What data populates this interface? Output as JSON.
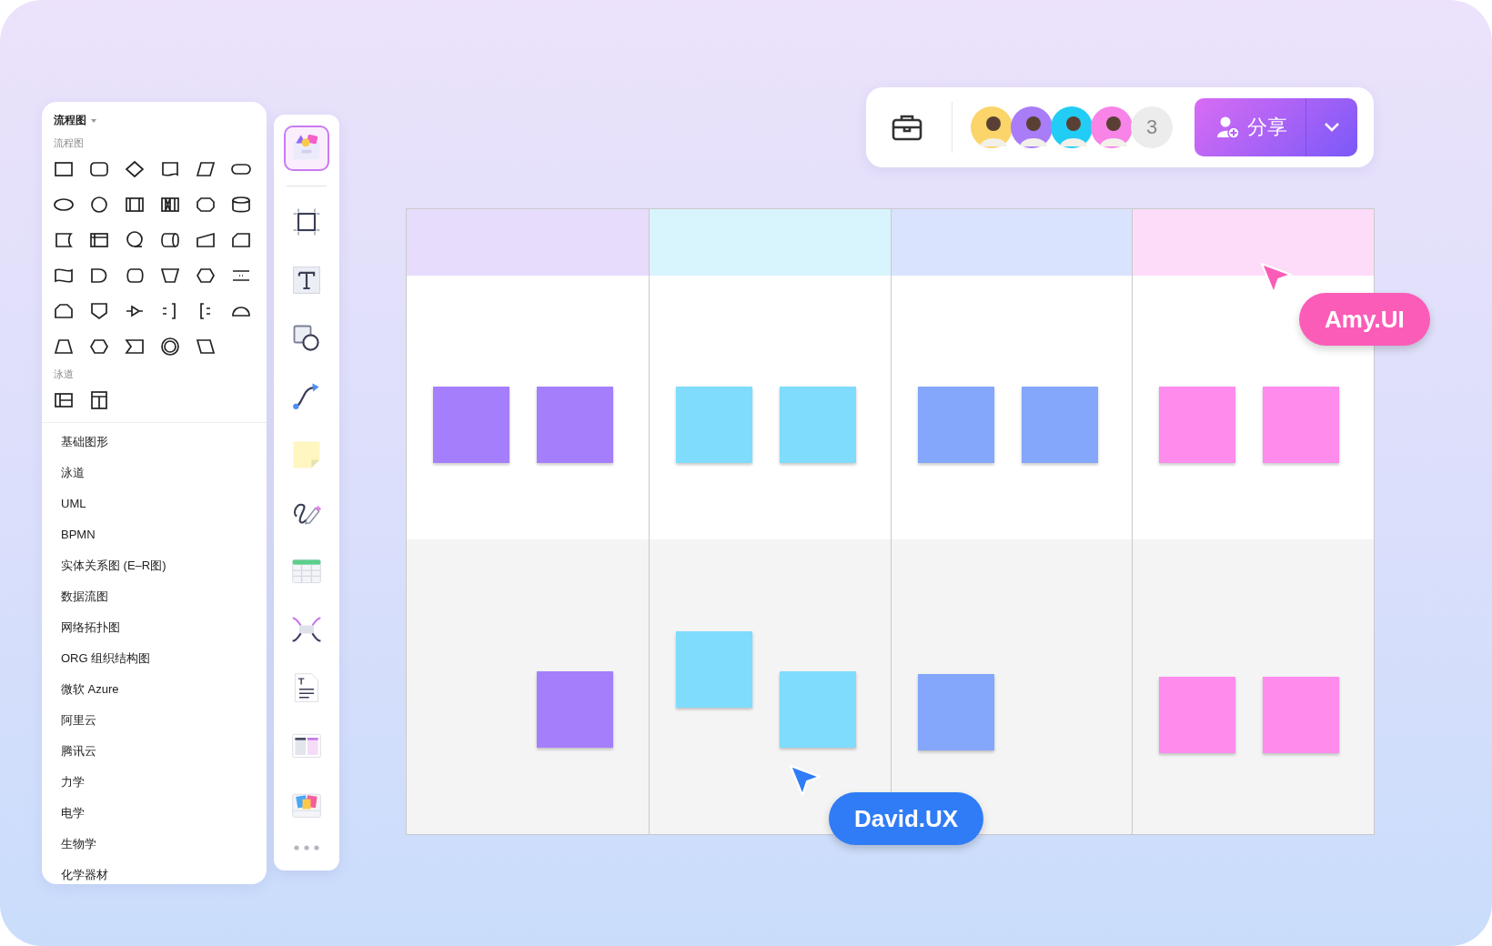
{
  "shape_panel": {
    "title": "流程图",
    "sections": [
      {
        "kind": "flowchart",
        "label": "流程图"
      },
      {
        "kind": "swimlane",
        "label": "泳道"
      }
    ],
    "categories": [
      "基础图形",
      "泳道",
      "UML",
      "BPMN",
      "实体关系图 (E–R图)",
      "数据流图",
      "网络拓扑图",
      "ORG 组织结构图",
      "微软 Azure",
      "阿里云",
      "腾讯云",
      "力学",
      "电学",
      "生物学",
      "化学器材"
    ]
  },
  "tools": [
    {
      "kind": "templates",
      "selected": true
    },
    {
      "kind": "frame",
      "selected": false
    },
    {
      "kind": "text",
      "selected": false
    },
    {
      "kind": "shape",
      "selected": false
    },
    {
      "kind": "connector",
      "selected": false
    },
    {
      "kind": "sticky",
      "selected": false
    },
    {
      "kind": "pen",
      "selected": false
    },
    {
      "kind": "table",
      "selected": false
    },
    {
      "kind": "mindmap",
      "selected": false
    },
    {
      "kind": "document",
      "selected": false
    },
    {
      "kind": "layout",
      "selected": false
    },
    {
      "kind": "media",
      "selected": false
    }
  ],
  "topbar": {
    "collaborators": [
      {
        "color": "#fbd46a"
      },
      {
        "color": "#a97cf8"
      },
      {
        "color": "#22cdf5"
      },
      {
        "color": "#f784e6"
      }
    ],
    "extra_count": "3",
    "share_button": "分享"
  },
  "board": {
    "lanes": [
      {
        "color": "#e8dcfc",
        "notes_top": [
          {
            "color": "#a57ffb"
          },
          {
            "color": "#a57ffb"
          }
        ],
        "notes_bottom": [
          {
            "color": "#a57ffb"
          }
        ]
      },
      {
        "color": "#d8f4fd",
        "notes_top": [
          {
            "color": "#7fdcfc"
          },
          {
            "color": "#7fdcfc"
          }
        ],
        "notes_bottom": [
          {
            "color": "#7fdcfc"
          },
          {
            "color": "#7fdcfc"
          }
        ]
      },
      {
        "color": "#d9e3fd",
        "notes_top": [
          {
            "color": "#84a7fb"
          },
          {
            "color": "#84a7fb"
          }
        ],
        "notes_bottom": [
          {
            "color": "#84a7fb"
          }
        ]
      },
      {
        "color": "#fcdcf8",
        "notes_top": [
          {
            "color": "#fd8ced"
          },
          {
            "color": "#fd8ced"
          }
        ],
        "notes_bottom": [
          {
            "color": "#fd8ced"
          },
          {
            "color": "#fd8ced"
          }
        ]
      }
    ]
  },
  "cursors": [
    {
      "name": "Amy.UI",
      "color": "#fb5cb8"
    },
    {
      "name": "David.UX",
      "color": "#2f7cf6"
    }
  ]
}
